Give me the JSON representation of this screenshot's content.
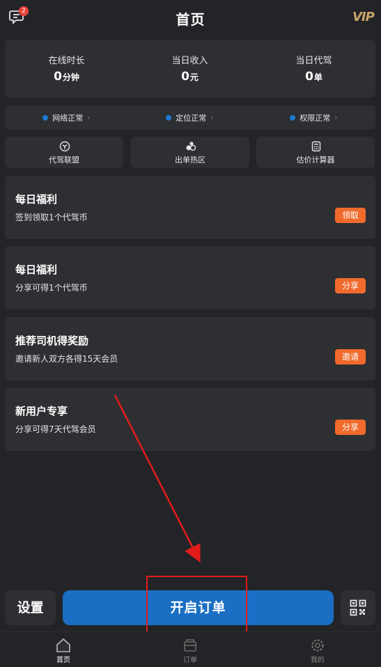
{
  "header": {
    "title": "首页",
    "message_badge": "2",
    "vip_label": "VIP"
  },
  "stats": [
    {
      "label": "在线时长",
      "value": "0",
      "unit": "分钟"
    },
    {
      "label": "当日收入",
      "value": "0",
      "unit": "元"
    },
    {
      "label": "当日代驾",
      "value": "0",
      "unit": "单"
    }
  ],
  "status": [
    {
      "label": "网络正常"
    },
    {
      "label": "定位正常"
    },
    {
      "label": "权限正常"
    }
  ],
  "tools": [
    {
      "label": "代驾联盟",
      "icon": "cube-icon"
    },
    {
      "label": "出单热区",
      "icon": "hotspot-icon"
    },
    {
      "label": "估价计算器",
      "icon": "calculator-icon"
    }
  ],
  "benefits": [
    {
      "title": "每日福利",
      "desc": "签到领取1个代驾币",
      "button": "领取"
    },
    {
      "title": "每日福利",
      "desc": "分享可得1个代驾币",
      "button": "分享"
    },
    {
      "title": "推荐司机得奖励",
      "desc": "邀请新人双方各得15天会员",
      "button": "邀请"
    },
    {
      "title": "新用户专享",
      "desc": "分享可得7天代驾会员",
      "button": "分享"
    }
  ],
  "actions": {
    "settings": "设置",
    "start_order": "开启订单"
  },
  "tabs": [
    {
      "label": "首页",
      "icon": "home-icon",
      "active": true
    },
    {
      "label": "订单",
      "icon": "orders-icon",
      "active": false
    },
    {
      "label": "我的",
      "icon": "gear-icon",
      "active": false
    }
  ],
  "colors": {
    "background": "#232427",
    "card": "#2e2f33",
    "accent_orange": "#f06a2c",
    "primary_blue": "#1a6fc4",
    "status_dot": "#1e78d0",
    "annotation_red": "#e31b1b",
    "vip_gold": "#c9a46a"
  }
}
